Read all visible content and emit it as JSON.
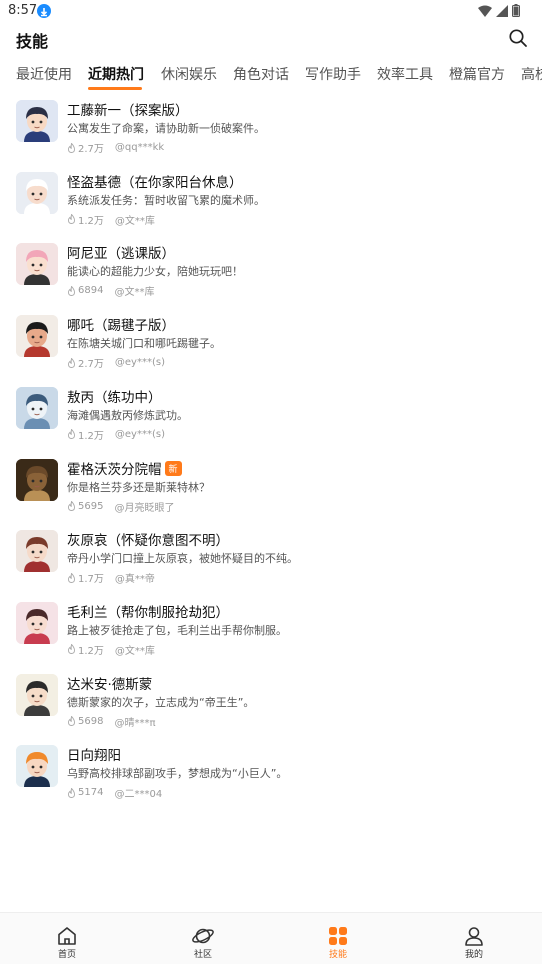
{
  "status_bar": {
    "time": "8:57"
  },
  "header": {
    "title": "技能"
  },
  "tabs": [
    {
      "label": "最近使用",
      "active": false
    },
    {
      "label": "近期热门",
      "active": true
    },
    {
      "label": "休闲娱乐",
      "active": false
    },
    {
      "label": "角色对话",
      "active": false
    },
    {
      "label": "写作助手",
      "active": false
    },
    {
      "label": "效率工具",
      "active": false
    },
    {
      "label": "橙篇官方",
      "active": false
    },
    {
      "label": "高校",
      "active": false
    }
  ],
  "skills": [
    {
      "name": "工藤新一（探案版）",
      "desc": "公寓发生了命案，请协助新一侦破案件。",
      "uses": "2.7万",
      "author": "@qq***kk",
      "badge": ""
    },
    {
      "name": "怪盗基德（在你家阳台休息）",
      "desc": "系统派发任务：暂时收留飞累的魔术师。",
      "uses": "1.2万",
      "author": "@文**库",
      "badge": ""
    },
    {
      "name": "阿尼亚（逃课版）",
      "desc": "能读心的超能力少女，陪她玩玩吧！",
      "uses": "6894",
      "author": "@文**库",
      "badge": ""
    },
    {
      "name": "哪吒（踢毽子版）",
      "desc": "在陈塘关城门口和哪吒踢毽子。",
      "uses": "2.7万",
      "author": "@ey***(s)",
      "badge": ""
    },
    {
      "name": "敖丙（练功中）",
      "desc": "海滩偶遇敖丙修炼武功。",
      "uses": "1.2万",
      "author": "@ey***(s)",
      "badge": ""
    },
    {
      "name": "霍格沃茨分院帽",
      "desc": "你是格兰芬多还是斯莱特林？",
      "uses": "5695",
      "author": "@月亮眨眼了",
      "badge": "新"
    },
    {
      "name": "灰原哀（怀疑你意图不明）",
      "desc": "帝丹小学门口撞上灰原哀，被她怀疑目的不纯。",
      "uses": "1.7万",
      "author": "@真**帝",
      "badge": ""
    },
    {
      "name": "毛利兰（帮你制服抢劫犯）",
      "desc": "路上被歹徒抢走了包，毛利兰出手帮你制服。",
      "uses": "1.2万",
      "author": "@文**库",
      "badge": ""
    },
    {
      "name": "达米安·德斯蒙",
      "desc": "德斯蒙家的次子，立志成为“帝王生”。",
      "uses": "5698",
      "author": "@晴***π",
      "badge": ""
    },
    {
      "name": "日向翔阳",
      "desc": "乌野高校排球部副攻手，梦想成为“小巨人”。",
      "uses": "5174",
      "author": "@二***04",
      "badge": ""
    }
  ],
  "avatars": [
    {
      "bg": "#dfe6f3",
      "hair": "#2a2f45",
      "skin": "#f7d9c4",
      "cloth": "#2a3d7a"
    },
    {
      "bg": "#e9edf3",
      "hair": "#ffffff",
      "skin": "#f7dccc",
      "cloth": "#ffffff"
    },
    {
      "bg": "#f3e2e2",
      "hair": "#f2a6b8",
      "skin": "#f9dfcf",
      "cloth": "#333333"
    },
    {
      "bg": "#f2ece6",
      "hair": "#1a1a1a",
      "skin": "#e7a98a",
      "cloth": "#b5382e"
    },
    {
      "bg": "#c9d9e8",
      "hair": "#3b5b7c",
      "skin": "#eef3f7",
      "cloth": "#6b8fb3"
    },
    {
      "bg": "#3a2a18",
      "hair": "#6b4a2a",
      "skin": "#8a6238",
      "cloth": "#b99056"
    },
    {
      "bg": "#efe7e2",
      "hair": "#7a3b2b",
      "skin": "#f5dac9",
      "cloth": "#a03030"
    },
    {
      "bg": "#f5e2e6",
      "hair": "#4a2a2a",
      "skin": "#f7dcd0",
      "cloth": "#c83c4f"
    },
    {
      "bg": "#f3efe3",
      "hair": "#2b2b2b",
      "skin": "#f6dcc8",
      "cloth": "#3c3c3c"
    },
    {
      "bg": "#e4eef3",
      "hair": "#f08a2c",
      "skin": "#f7d7c1",
      "cloth": "#1c2f4d"
    }
  ],
  "bottom_nav": [
    {
      "label": "首页",
      "icon": "home-icon",
      "active": false
    },
    {
      "label": "社区",
      "icon": "planet-icon",
      "active": false
    },
    {
      "label": "技能",
      "icon": "grid-icon",
      "active": true
    },
    {
      "label": "我的",
      "icon": "person-icon",
      "active": false
    }
  ],
  "colors": {
    "accent": "#ff7a1a",
    "text": "#111111",
    "subtext": "#555555",
    "meta": "#9a9a9a"
  }
}
